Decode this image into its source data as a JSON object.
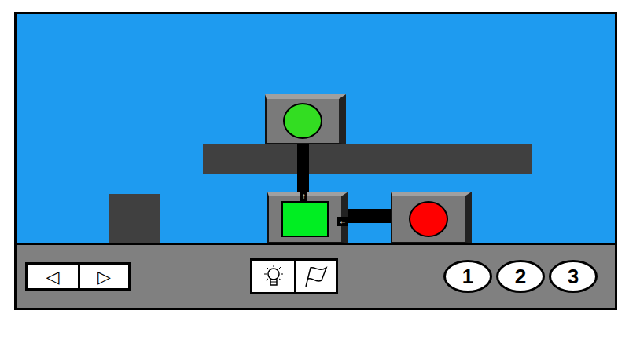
{
  "scene": {
    "lights": [
      {
        "name": "top-light",
        "color": "#33dd22"
      },
      {
        "name": "right-light",
        "color": "#ff0000"
      }
    ],
    "switch": {
      "color": "#00ee22",
      "inputs": [
        "↑",
        "←"
      ]
    }
  },
  "nav": {
    "buttons": [
      "◁",
      "▷"
    ]
  },
  "levels": [
    {
      "label": "1",
      "selected": false
    },
    {
      "label": "2",
      "selected": false
    },
    {
      "label": "3",
      "selected": false
    }
  ]
}
